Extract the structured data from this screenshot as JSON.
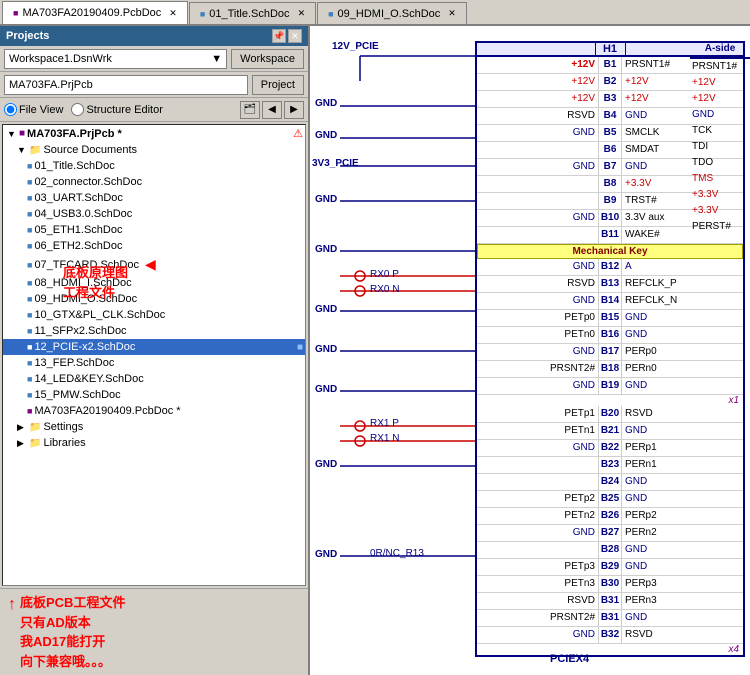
{
  "app": {
    "title": "Projects",
    "tabs": [
      {
        "id": "pcb",
        "label": "MA703FA20190409.PcbDoc",
        "active": true
      },
      {
        "id": "title",
        "label": "01_Title.SchDoc",
        "active": false
      },
      {
        "id": "hdmi",
        "label": "09_HDMI_O.SchDoc",
        "active": false
      }
    ]
  },
  "left_panel": {
    "title": "Projects",
    "workspace_label": "Workspace1.DsnWrk",
    "workspace_btn": "Workspace",
    "project_label": "MA703FA.PrjPcb",
    "project_btn": "Project",
    "view_file": "File View",
    "view_structure": "Structure Editor",
    "tree": [
      {
        "id": "root",
        "label": "MA703FA.PrjPcb *",
        "indent": 0,
        "type": "prjpcb",
        "expanded": true
      },
      {
        "id": "src_docs",
        "label": "Source Documents",
        "indent": 1,
        "type": "folder",
        "expanded": true
      },
      {
        "id": "title_sch",
        "label": "01_Title.SchDoc",
        "indent": 2,
        "type": "sch"
      },
      {
        "id": "connector_sch",
        "label": "02_connector.SchDoc",
        "indent": 2,
        "type": "sch"
      },
      {
        "id": "uart_sch",
        "label": "03_UART.SchDoc",
        "indent": 2,
        "type": "sch"
      },
      {
        "id": "usb_sch",
        "label": "04_USB3.0.SchDoc",
        "indent": 2,
        "type": "sch"
      },
      {
        "id": "eth1_sch",
        "label": "05_ETH1.SchDoc",
        "indent": 2,
        "type": "sch"
      },
      {
        "id": "eth2_sch",
        "label": "06_ETH2.SchDoc",
        "indent": 2,
        "type": "sch"
      },
      {
        "id": "tfcard_sch",
        "label": "07_TFCARD.SchDoc",
        "indent": 2,
        "type": "sch",
        "annotated": true
      },
      {
        "id": "hdmi_i_sch",
        "label": "08_HDMI_I.SchDoc",
        "indent": 2,
        "type": "sch"
      },
      {
        "id": "hdmi_o_sch",
        "label": "09_HDMI_O.SchDoc",
        "indent": 2,
        "type": "sch"
      },
      {
        "id": "gtx_sch",
        "label": "10_GTX&PL_CLK.SchDoc",
        "indent": 2,
        "type": "sch"
      },
      {
        "id": "sfpx2_sch",
        "label": "11_SFPx2.SchDoc",
        "indent": 2,
        "type": "sch"
      },
      {
        "id": "pcie_sch",
        "label": "12_PCIE-x2.SchDoc",
        "indent": 2,
        "type": "sch",
        "selected": true
      },
      {
        "id": "fep_sch",
        "label": "13_FEP.SchDoc",
        "indent": 2,
        "type": "sch"
      },
      {
        "id": "led_sch",
        "label": "14_LED&KEY.SchDoc",
        "indent": 2,
        "type": "sch"
      },
      {
        "id": "pmw_sch",
        "label": "15_PMW.SchDoc",
        "indent": 2,
        "type": "sch"
      },
      {
        "id": "pcb_doc",
        "label": "MA703FA20190409.PcbDoc *",
        "indent": 2,
        "type": "pcb"
      },
      {
        "id": "settings",
        "label": "Settings",
        "indent": 1,
        "type": "folder"
      },
      {
        "id": "libraries",
        "label": "Libraries",
        "indent": 1,
        "type": "folder"
      }
    ]
  },
  "annotations": {
    "arrow1_text": "底板原理图\n工程文件",
    "arrow2_text": "底板PCB工程文件\n只有AD版本\n我AD17能打开\n向下兼容哦。。。"
  },
  "schematic": {
    "net_label_12v": "12V_PCIE",
    "net_label_3v3": "3V3_PCIE",
    "connector_name": "H1",
    "connector_part": "PCIEX4",
    "mech_key_label": "Mechanical Key",
    "x1_label": "x1",
    "x4_label": "x4",
    "signals_left": [
      {
        "pin": "B1",
        "net": ""
      },
      {
        "pin": "B2",
        "net": ""
      },
      {
        "pin": "B3",
        "net": ""
      },
      {
        "pin": "B4",
        "net": ""
      },
      {
        "pin": "B5",
        "net": ""
      },
      {
        "pin": "B6",
        "net": ""
      },
      {
        "pin": "B7",
        "net": ""
      },
      {
        "pin": "B8",
        "net": ""
      },
      {
        "pin": "B9",
        "net": ""
      },
      {
        "pin": "B10",
        "net": ""
      },
      {
        "pin": "B11",
        "net": ""
      }
    ],
    "rows": [
      {
        "pin": "B1",
        "left": "",
        "right": "+12V",
        "right2": "PRSNT1#"
      },
      {
        "pin": "B2",
        "left": "+12V",
        "right": "+12V",
        "right2": ""
      },
      {
        "pin": "B3",
        "left": "+12V",
        "right": "+12V",
        "right2": ""
      },
      {
        "pin": "B4",
        "left": "RSVD",
        "right": "GND",
        "right2": ""
      },
      {
        "pin": "B5",
        "left": "GND",
        "right": "SMCLK",
        "right2": "TCK"
      },
      {
        "pin": "B6",
        "left": "",
        "right": "SMDAT",
        "right2": "TDI"
      },
      {
        "pin": "B7",
        "left": "GND",
        "right": "GND",
        "right2": "TDO"
      },
      {
        "pin": "B8",
        "left": "",
        "right": "+3.3V",
        "right2": "TMS"
      },
      {
        "pin": "B9",
        "left": "",
        "right": "TRST#",
        "right2": "+3.3V"
      },
      {
        "pin": "B10",
        "left": "GND",
        "right": "3.3V aux",
        "right2": "+3.3V"
      },
      {
        "pin": "B11",
        "left": "",
        "right": "WAKE#",
        "right2": "PERST#"
      }
    ],
    "mech_rows": [
      {
        "pin": "B12",
        "left": "GND",
        "right": "A"
      },
      {
        "pin": "B13",
        "left": "RSVD",
        "right": "REFCLK_P"
      },
      {
        "pin": "B14",
        "left": "GND",
        "right": "REFCLK_N"
      },
      {
        "pin": "B15",
        "left": "PETp0",
        "right": "GND"
      },
      {
        "pin": "B16",
        "left": "PETn0",
        "right": "GND"
      },
      {
        "pin": "B17",
        "left": "GND",
        "right": "PERp0"
      },
      {
        "pin": "B18",
        "left": "PRSNT2#",
        "right": "PERn0"
      },
      {
        "pin": "B19",
        "left": "GND",
        "right": "GND"
      }
    ],
    "rx_labels": [
      "RX0 P",
      "RX0 N",
      "RX1 P",
      "RX1 N"
    ]
  }
}
